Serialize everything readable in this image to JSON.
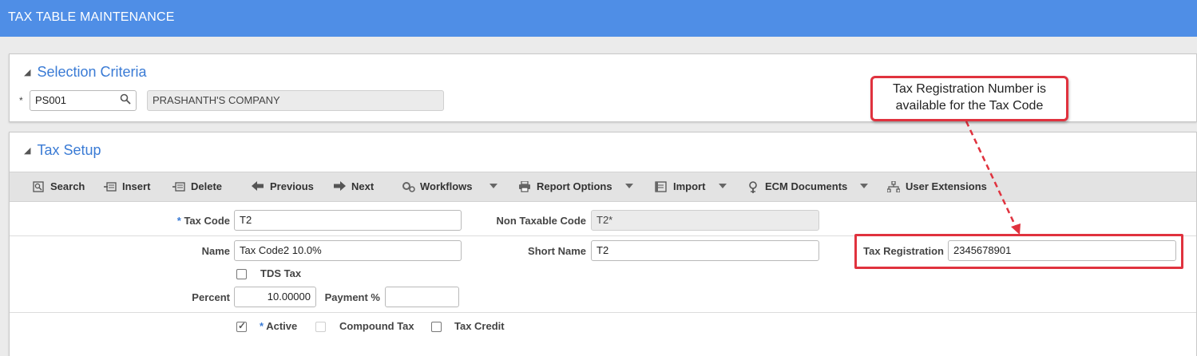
{
  "window": {
    "title": "TAX TABLE MAINTENANCE"
  },
  "selection": {
    "title": "Selection Criteria",
    "required_marker": "*",
    "company_code": "PS001",
    "company_name": "PRASHANTH'S COMPANY"
  },
  "tax_setup": {
    "title": "Tax Setup",
    "toolbar": [
      {
        "label": "Search",
        "icon": "search-icon"
      },
      {
        "label": "Insert",
        "icon": "insert-icon"
      },
      {
        "label": "Delete",
        "icon": "delete-icon"
      },
      {
        "label": "Previous",
        "icon": "arrow-left-icon"
      },
      {
        "label": "Next",
        "icon": "arrow-right-icon"
      },
      {
        "label": "Workflows",
        "icon": "gears-icon"
      },
      {
        "label": "Report Options",
        "icon": "printer-icon"
      },
      {
        "label": "Import",
        "icon": "import-icon"
      },
      {
        "label": "ECM Documents",
        "icon": "ecm-icon"
      },
      {
        "label": "User Extensions",
        "icon": "hierarchy-icon"
      }
    ],
    "fields": {
      "tax_code_label": "Tax Code",
      "tax_code_value": "T2",
      "non_taxable_code_label": "Non Taxable Code",
      "non_taxable_code_value": "T2*",
      "name_label": "Name",
      "name_value": "Tax Code2 10.0%",
      "short_name_label": "Short Name",
      "short_name_value": "T2",
      "tax_registration_label": "Tax Registration",
      "tax_registration_value": "2345678901",
      "tds_tax_label": "TDS Tax",
      "percent_label": "Percent",
      "percent_value": "10.00000",
      "payment_pct_label": "Payment %",
      "payment_pct_value": "",
      "active_label": "Active",
      "compound_tax_label": "Compound Tax",
      "tax_credit_label": "Tax Credit"
    },
    "checkboxes": {
      "tds_tax": false,
      "active": true,
      "compound_tax": false,
      "tax_credit": false
    }
  },
  "annotation": {
    "callout_line1": "Tax Registration Number is",
    "callout_line2": "available for the Tax Code",
    "color": "#e0323e"
  },
  "colors": {
    "header": "#4f8ee6",
    "accent": "#3a7bd5"
  }
}
